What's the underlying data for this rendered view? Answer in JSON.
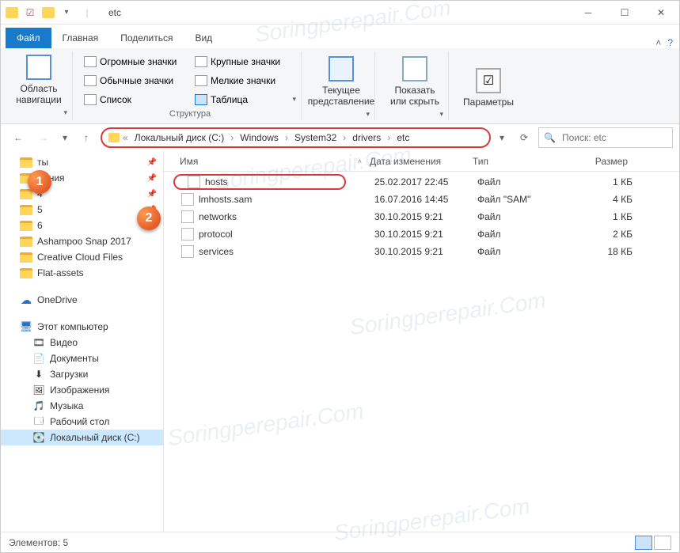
{
  "window": {
    "title": "etc"
  },
  "tabs": {
    "file": "Файл",
    "home": "Главная",
    "share": "Поделиться",
    "view": "Вид"
  },
  "ribbon": {
    "nav_pane": "Область навигации",
    "extra_large": "Огромные значки",
    "large": "Крупные значки",
    "medium": "Обычные значки",
    "small": "Мелкие значки",
    "list": "Список",
    "details": "Таблица",
    "layout_group": "Структура",
    "current_view": "Текущее представление",
    "show_hide": "Показать или скрыть",
    "options": "Параметры"
  },
  "breadcrumbs": [
    "Локальный диск (C:)",
    "Windows",
    "System32",
    "drivers",
    "etc"
  ],
  "search": {
    "placeholder": "Поиск: etc"
  },
  "columns": {
    "name": "Имя",
    "date": "Дата изменения",
    "type": "Тип",
    "size": "Размер"
  },
  "files": [
    {
      "name": "hosts",
      "date": "25.02.2017 22:45",
      "type": "Файл",
      "size": "1 КБ",
      "hl": true
    },
    {
      "name": "lmhosts.sam",
      "date": "16.07.2016 14:45",
      "type": "Файл \"SAM\"",
      "size": "4 КБ",
      "hl": false
    },
    {
      "name": "networks",
      "date": "30.10.2015 9:21",
      "type": "Файл",
      "size": "1 КБ",
      "hl": false
    },
    {
      "name": "protocol",
      "date": "30.10.2015 9:21",
      "type": "Файл",
      "size": "2 КБ",
      "hl": false
    },
    {
      "name": "services",
      "date": "30.10.2015 9:21",
      "type": "Файл",
      "size": "18 КБ",
      "hl": false
    }
  ],
  "sidebar": {
    "quick": [
      {
        "label": "ты",
        "pin": true
      },
      {
        "label": "жения",
        "pin": true
      },
      {
        "label": "4",
        "pin": true
      },
      {
        "label": "5",
        "pin": true
      },
      {
        "label": "6",
        "pin": true
      },
      {
        "label": "Ashampoo Snap 2017",
        "pin": false
      },
      {
        "label": "Creative Cloud Files",
        "pin": false
      },
      {
        "label": "Flat-assets",
        "pin": false
      }
    ],
    "onedrive": "OneDrive",
    "thispc": "Этот компьютер",
    "pc_items": [
      "Видео",
      "Документы",
      "Загрузки",
      "Изображения",
      "Музыка",
      "Рабочий стол",
      "Локальный диск (C:)"
    ]
  },
  "statusbar": {
    "count_label": "Элементов: 5"
  },
  "callouts": {
    "one": "1",
    "two": "2"
  },
  "watermark": "Soringperepair.Com"
}
